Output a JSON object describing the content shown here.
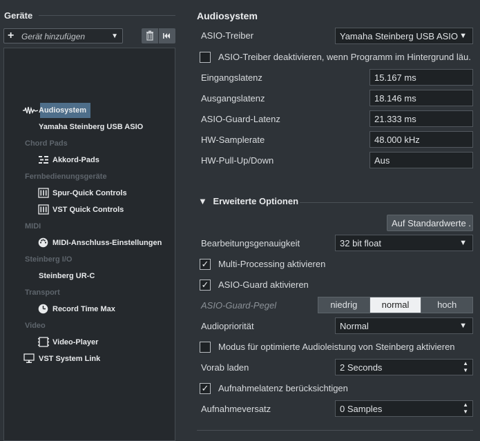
{
  "left": {
    "title": "Geräte",
    "add_label": "Gerät hinzufügen",
    "tree": [
      {
        "kind": "item",
        "label": "Audiosystem",
        "icon": "waveform-icon"
      },
      {
        "kind": "item",
        "label": "Yamaha Steinberg USB ASIO",
        "icon": ""
      },
      {
        "kind": "category",
        "label": "Chord Pads"
      },
      {
        "kind": "item",
        "label": "Akkord-Pads",
        "icon": "chord-pads-icon"
      },
      {
        "kind": "category",
        "label": "Fernbedienungsgeräte"
      },
      {
        "kind": "item",
        "label": "Spur-Quick Controls",
        "icon": "controller-icon"
      },
      {
        "kind": "item",
        "label": "VST Quick Controls",
        "icon": "controller-icon"
      },
      {
        "kind": "category",
        "label": "MIDI"
      },
      {
        "kind": "item",
        "label": "MIDI-Anschluss-Einstellungen",
        "icon": "midi-port-icon"
      },
      {
        "kind": "category",
        "label": "Steinberg I/O"
      },
      {
        "kind": "item",
        "label": "Steinberg UR-C",
        "icon": ""
      },
      {
        "kind": "category",
        "label": "Transport"
      },
      {
        "kind": "item",
        "label": "Record Time Max",
        "icon": "clock-icon"
      },
      {
        "kind": "category",
        "label": "Video"
      },
      {
        "kind": "item",
        "label": "Video-Player",
        "icon": "film-icon"
      },
      {
        "kind": "item",
        "label": "VST System Link",
        "icon": "monitor-icon"
      }
    ]
  },
  "right": {
    "title": "Audiosystem",
    "asio_driver_label": "ASIO-Treiber",
    "asio_driver_value": "Yamaha Steinberg USB ASIO",
    "asio_disable_label": "ASIO-Treiber deaktivieren, wenn Programm im Hintergrund läu.",
    "asio_disable_checked": false,
    "input_latency_label": "Eingangslatenz",
    "input_latency_value": "15.167 ms",
    "output_latency_label": "Ausgangslatenz",
    "output_latency_value": "18.146 ms",
    "guard_latency_label": "ASIO-Guard-Latenz",
    "guard_latency_value": "21.333 ms",
    "samplerate_label": "HW-Samplerate",
    "samplerate_value": "48.000 kHz",
    "pullup_label": "HW-Pull-Up/Down",
    "pullup_value": "Aus",
    "advanced": {
      "heading": "Erweiterte Optionen",
      "reset_button": "Auf Standardwerte .",
      "precision_label": "Bearbeitungsgenauigkeit",
      "precision_value": "32 bit float",
      "multiprocessing_label": "Multi-Processing aktivieren",
      "multiprocessing_checked": true,
      "asio_guard_label": "ASIO-Guard aktivieren",
      "asio_guard_checked": true,
      "guard_level_label": "ASIO-Guard-Pegel",
      "guard_levels": [
        "niedrig",
        "normal",
        "hoch"
      ],
      "guard_level_selected": "normal",
      "priority_label": "Audiopriorität",
      "priority_value": "Normal",
      "steinberg_mode_label": "Modus für optimierte Audioleistung von Steinberg aktivieren",
      "steinberg_mode_checked": false,
      "preload_label": "Vorab laden",
      "preload_value": "2 Seconds",
      "rec_latency_label": "Aufnahmelatenz berücksichtigen",
      "rec_latency_checked": true,
      "rec_offset_label": "Aufnahmeversatz",
      "rec_offset_value": "0 Samples"
    }
  },
  "colors": {
    "background": "#2e3338",
    "tree_background": "#25292d",
    "selection": "#4e6e8a",
    "segment_active": "#eef0f2"
  }
}
